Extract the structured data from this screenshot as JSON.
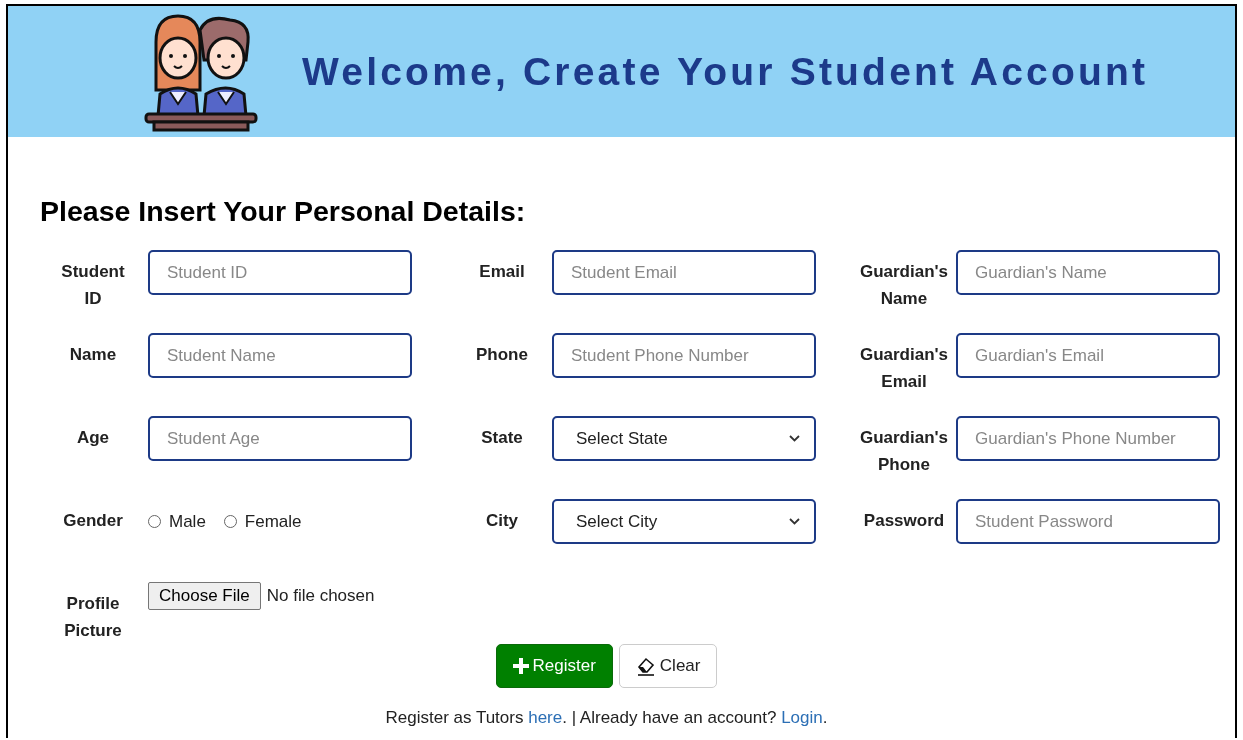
{
  "header": {
    "title": "Welcome, Create Your Student Account"
  },
  "form": {
    "heading": "Please Insert Your Personal Details:",
    "fields": [
      {
        "label": "Student ID",
        "kind": "text",
        "placeholder": "Student ID"
      },
      {
        "label": "Email",
        "kind": "text",
        "placeholder": "Student Email"
      },
      {
        "label": "Guardian's Name",
        "kind": "text",
        "placeholder": "Guardian's Name"
      },
      {
        "label": "Name",
        "kind": "text",
        "placeholder": "Student Name"
      },
      {
        "label": "Phone",
        "kind": "text",
        "placeholder": "Student Phone Number"
      },
      {
        "label": "Guardian's Email",
        "kind": "text",
        "placeholder": "Guardian's Email"
      },
      {
        "label": "Age",
        "kind": "text",
        "placeholder": "Student Age"
      },
      {
        "label": "State",
        "kind": "select",
        "value": "Select State"
      },
      {
        "label": "Guardian's Phone",
        "kind": "text",
        "placeholder": "Guardian's Phone Number"
      },
      {
        "label": "Gender",
        "kind": "radio",
        "options": [
          {
            "label": "Male",
            "selected": false
          },
          {
            "label": "Female",
            "selected": false
          }
        ]
      },
      {
        "label": "City",
        "kind": "select",
        "value": "Select City"
      },
      {
        "label": "Password",
        "kind": "text",
        "placeholder": "Student Password"
      },
      {
        "label": "Profile Picture",
        "kind": "file",
        "button": "Choose File",
        "status": "No file chosen"
      }
    ],
    "buttons": [
      {
        "label": "Register",
        "kind": "primary"
      },
      {
        "label": "Clear",
        "kind": "secondary"
      }
    ],
    "footer": [
      {
        "text": "Register as Tutors ",
        "kind": "text"
      },
      {
        "text": "here",
        "kind": "link"
      },
      {
        "text": ". | Already have an account? ",
        "kind": "text"
      },
      {
        "text": "Login",
        "kind": "link"
      },
      {
        "text": ".",
        "kind": "text"
      }
    ]
  }
}
